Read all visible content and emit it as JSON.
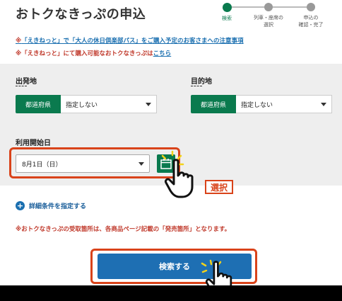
{
  "page": {
    "title": "おトクなきっぷの申込"
  },
  "steps": [
    {
      "label": "検索"
    },
    {
      "label": "列車・座席の\n選択"
    },
    {
      "label": "申込の\n確認・完了"
    }
  ],
  "notices": {
    "link1_mark": "※",
    "link1_text": "「えきねっと」で「大人の休日倶楽部パス」をご購入予定のお客さまへの注意事項",
    "note2_text": "※「えきねっと」にて購入可能なおトクなきっぷは",
    "note2_link": "こちら"
  },
  "departure": {
    "label": "出発地",
    "tag": "都道府県",
    "value": "指定しない"
  },
  "destination": {
    "label": "目的地",
    "tag": "都道府県",
    "value": "指定しない"
  },
  "start_date": {
    "label": "利用開始日",
    "value": "8月1日（日）"
  },
  "annotation": {
    "select_label": "選択"
  },
  "detail": {
    "plus": "+",
    "label": "詳細条件を指定する"
  },
  "warning": "※おトクなきっぷの受取箇所は、各商品ページ記載の「発売箇所」となります。",
  "search": {
    "label": "検索する"
  },
  "colors": {
    "green": "#0a7a4e",
    "blue": "#1e6fb3",
    "red": "#d9431a"
  },
  "icons": {
    "calendar": "calendar-icon",
    "hand": "pointing-hand-icon"
  }
}
